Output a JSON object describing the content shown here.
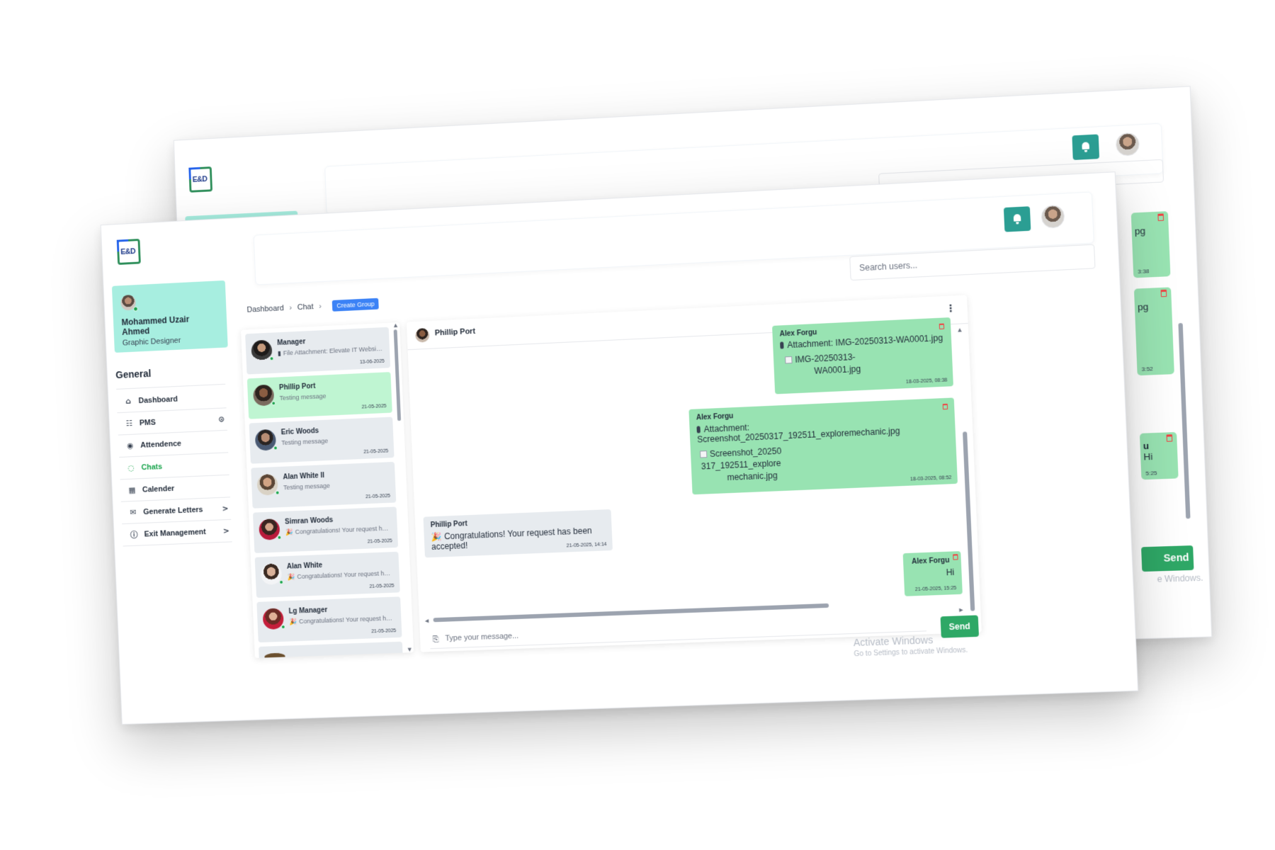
{
  "app": {
    "logo_text": "E&D"
  },
  "back_window": {
    "send_label": "Send",
    "activate_text": "e Windows.",
    "bubble_texts": [
      "pg",
      "pg",
      "u",
      "Hi"
    ],
    "bubble_times": [
      "3:38",
      "3:52",
      "5:25"
    ]
  },
  "profile": {
    "name": "Mohammed Uzair Ahmed",
    "role": "Graphic Designer"
  },
  "nav": {
    "section": "General",
    "items": [
      {
        "label": "Dashboard",
        "icon": "home-icon"
      },
      {
        "label": "PMS",
        "icon": "pms-icon",
        "trail": "⊙"
      },
      {
        "label": "Attendence",
        "icon": "fingerprint-icon"
      },
      {
        "label": "Chats",
        "icon": "chat-icon",
        "active": true
      },
      {
        "label": "Calender",
        "icon": "calendar-icon"
      },
      {
        "label": "Generate Letters",
        "icon": "mail-icon",
        "trail": ">"
      },
      {
        "label": "Exit Management",
        "icon": "info-icon",
        "trail": ">"
      }
    ]
  },
  "breadcrumb": {
    "items": [
      "Dashboard",
      "Chat"
    ],
    "sep": "›",
    "create_group": "Create Group"
  },
  "search": {
    "placeholder": "Search users..."
  },
  "chats": [
    {
      "name": "Manager",
      "preview": "File Attachment: Elevate IT Website ...",
      "date": "13-06-2025",
      "has_clip": true
    },
    {
      "name": "Phillip Port",
      "preview": "Testing message",
      "date": "21-05-2025",
      "active": true
    },
    {
      "name": "Eric Woods",
      "preview": "Testing message",
      "date": "21-05-2025"
    },
    {
      "name": "Alan White II",
      "preview": "Testing message",
      "date": "21-05-2025"
    },
    {
      "name": "Simran Woods",
      "preview": "Congratulations! Your request has...",
      "date": "21-05-2025",
      "has_party": true
    },
    {
      "name": "Alan White",
      "preview": "Congratulations! Your request has...",
      "date": "21-05-2025",
      "has_party": true
    },
    {
      "name": "Lg Manager",
      "preview": "Congratulations! Your request has...",
      "date": "21-05-2025",
      "has_party": true
    }
  ],
  "conversation": {
    "contact": "Phillip Port",
    "messages": [
      {
        "sender": "Alex Forgu",
        "text": "Attachment: IMG-20250313-WA0001.jpg",
        "image_lines": [
          "IMG-20250313-",
          "WA0001.jpg"
        ],
        "time": "18-03-2025, 08:38",
        "dir": "out"
      },
      {
        "sender": "Alex Forgu",
        "text": "Attachment: Screenshot_20250317_192511_exploremechanic.jpg",
        "image_lines": [
          "Screenshot_20250",
          "317_192511_explore",
          "mechanic.jpg"
        ],
        "time": "18-03-2025, 08:52",
        "dir": "out"
      },
      {
        "sender": "Phillip Port",
        "text": "Congratulations! Your request has been accepted!",
        "time": "21-05-2025, 14:14",
        "dir": "in"
      },
      {
        "sender": "Alex Forgu",
        "text": "Hi",
        "time": "21-05-2025, 15:25",
        "dir": "out"
      }
    ],
    "input_placeholder": "Type your message...",
    "send_label": "Send"
  },
  "watermark": {
    "line1": "Activate Windows",
    "line2": "Go to Settings to activate Windows."
  },
  "colors": {
    "accent_teal": "#2b9e93",
    "send_green": "#2ea866",
    "bubble_out": "#98e3b2",
    "bubble_in": "#e7ebef",
    "profile_bg": "#a7eee0",
    "create_group_blue": "#3b82f6"
  }
}
